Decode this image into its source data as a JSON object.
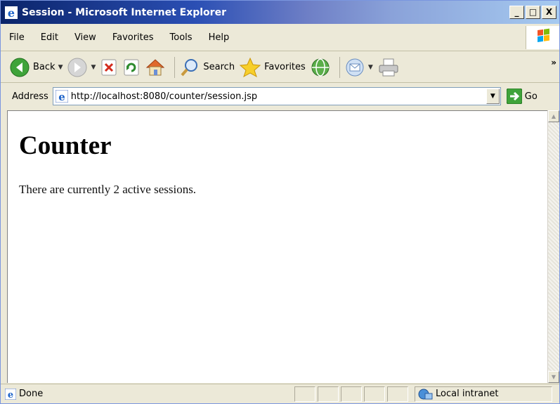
{
  "window": {
    "title": "Session - Microsoft Internet Explorer",
    "buttons": {
      "minimize": "_",
      "maximize": "□",
      "close": "X"
    }
  },
  "menu": [
    "File",
    "Edit",
    "View",
    "Favorites",
    "Tools",
    "Help"
  ],
  "toolbar": {
    "back_label": "Back",
    "search_label": "Search",
    "favorites_label": "Favorites",
    "more": "»"
  },
  "address": {
    "label": "Address",
    "url": "http://localhost:8080/counter/session.jsp",
    "go_label": "Go"
  },
  "page": {
    "heading": "Counter",
    "text": "There are currently 2 active sessions."
  },
  "status": {
    "text": "Done",
    "zone": "Local intranet"
  },
  "colors": {
    "title_gradient_start": "#0A246A",
    "title_gradient_end": "#A6CAF0",
    "chrome_bg": "#ECE9D8"
  }
}
